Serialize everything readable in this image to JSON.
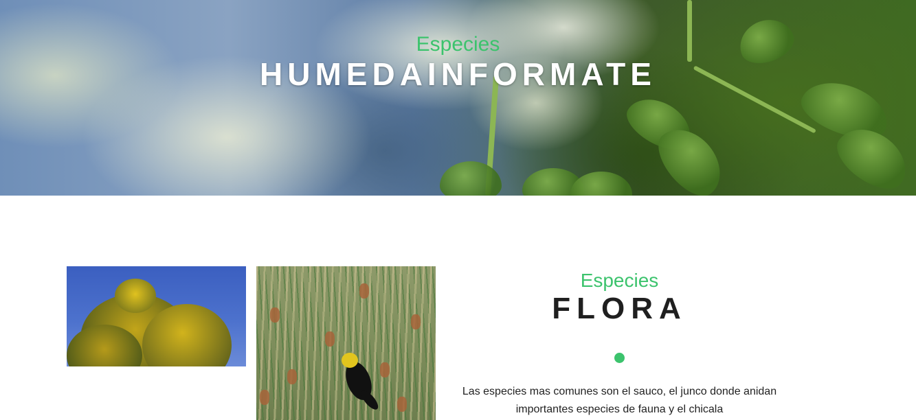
{
  "hero": {
    "subtitle": "Especies",
    "title": "HUMEDAINFORMATE"
  },
  "section": {
    "subtitle": "Especies",
    "title": "FLORA",
    "description": "Las especies mas comunes son el sauco, el junco donde anidan importantes especies de fauna y el chicala"
  },
  "colors": {
    "accent": "#3cc36d",
    "title_dark": "#1f1f1f",
    "hero_title": "#ffffff"
  }
}
